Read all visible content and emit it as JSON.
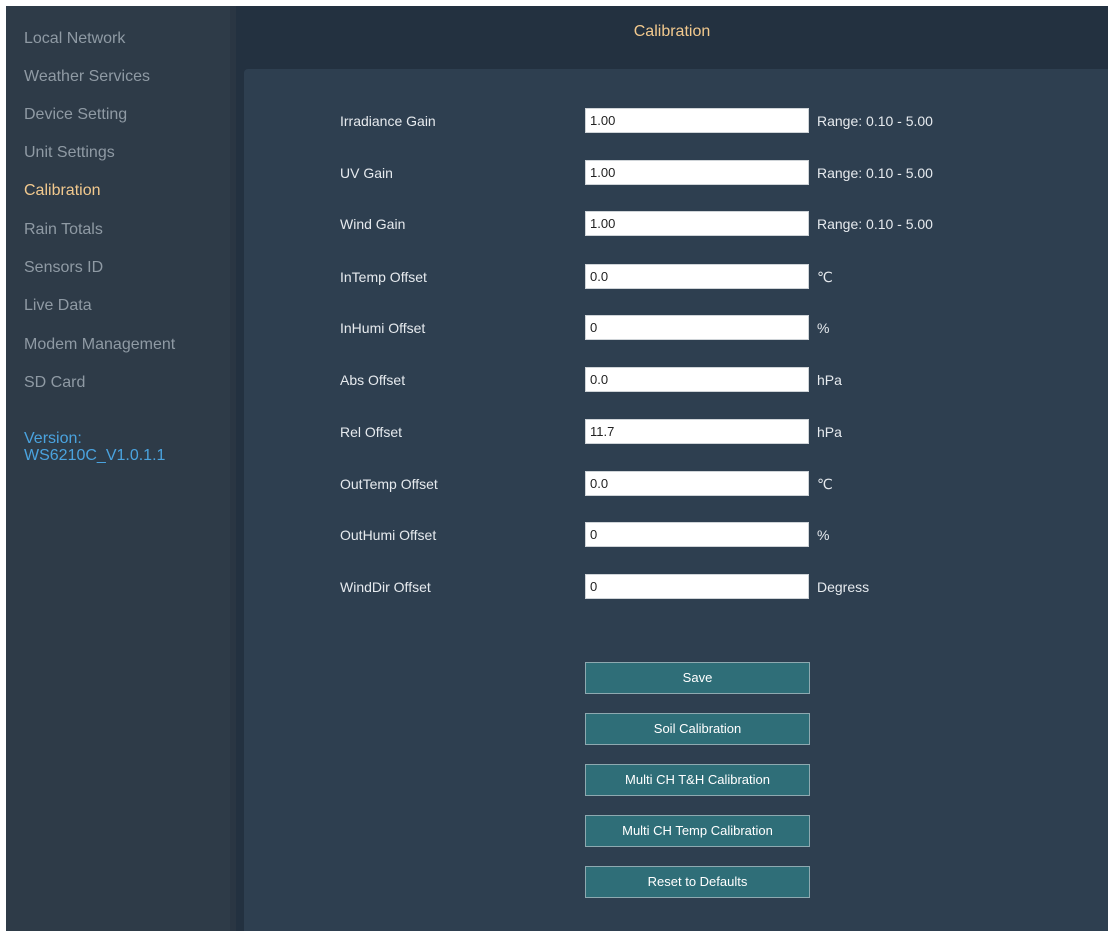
{
  "sidebar": {
    "items": [
      {
        "label": "Local Network"
      },
      {
        "label": "Weather Services"
      },
      {
        "label": "Device Setting"
      },
      {
        "label": "Unit Settings"
      },
      {
        "label": "Calibration",
        "active": true
      },
      {
        "label": "Rain Totals"
      },
      {
        "label": "Sensors ID"
      },
      {
        "label": "Live Data"
      },
      {
        "label": "Modem Management"
      },
      {
        "label": "SD Card"
      }
    ],
    "version_label": "Version:",
    "version_value": "WS6210C_V1.0.1.1"
  },
  "header": {
    "title": "Calibration"
  },
  "form": {
    "fields": [
      {
        "label": "Irradiance Gain",
        "value": "1.00",
        "note": "Range: 0.10 - 5.00"
      },
      {
        "label": "UV Gain",
        "value": "1.00",
        "note": "Range: 0.10 - 5.00"
      },
      {
        "label": "Wind Gain",
        "value": "1.00",
        "note": "Range: 0.10 - 5.00"
      },
      {
        "label": "InTemp Offset",
        "value": "0.0",
        "note": "℃"
      },
      {
        "label": "InHumi Offset",
        "value": "0",
        "note": "%"
      },
      {
        "label": "Abs Offset",
        "value": "0.0",
        "note": "hPa"
      },
      {
        "label": "Rel Offset",
        "value": "11.7",
        "note": "hPa"
      },
      {
        "label": "OutTemp Offset",
        "value": "0.0",
        "note": "℃"
      },
      {
        "label": "OutHumi Offset",
        "value": "0",
        "note": "%"
      },
      {
        "label": "WindDir Offset",
        "value": "0",
        "note": "Degress"
      }
    ]
  },
  "actions": {
    "save": "Save",
    "soil": "Soil Calibration",
    "multi_th": "Multi CH T&H Calibration",
    "multi_temp": "Multi CH Temp Calibration",
    "reset": "Reset to Defaults"
  },
  "colors": {
    "sidebar_bg": "#2e3b48",
    "header_bg": "#233140",
    "panel_bg": "#2e3f50",
    "active_accent": "#f2c98e",
    "version_blue": "#4aa3df",
    "button_bg": "#2f6e78"
  }
}
